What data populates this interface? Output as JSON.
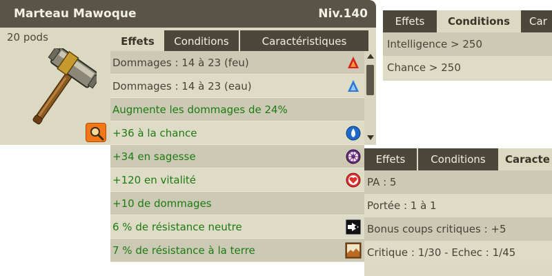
{
  "item": {
    "name": "Marteau Mawoque",
    "level": "Niv.140",
    "pods": "20 pods"
  },
  "tabs": {
    "effects": "Effets",
    "conditions": "Conditions",
    "characteristics": "Caractéristiques",
    "characteristics_cut_top": "Car",
    "characteristics_cut_bottom": "Caracte"
  },
  "effects": [
    {
      "text": "Dommages : 14 à 23 (feu)",
      "icon": "fire-element-icon"
    },
    {
      "text": "Dommages : 14 à 23 (eau)",
      "icon": "water-element-icon"
    },
    {
      "text": "Augmente les dommages de 24%",
      "icon": ""
    },
    {
      "text": "+36 à la chance",
      "icon": "chance-icon"
    },
    {
      "text": "+34 en sagesse",
      "icon": "wisdom-icon"
    },
    {
      "text": "+120 en vitalité",
      "icon": "vitality-heart-icon"
    },
    {
      "text": "+10 de dommages",
      "icon": ""
    },
    {
      "text": "6 % de résistance neutre",
      "icon": "neutral-resistance-icon"
    },
    {
      "text": "7 % de résistance à la terre",
      "icon": "earth-resistance-icon"
    }
  ],
  "conditions": [
    "Intelligence > 250",
    "Chance > 250"
  ],
  "characteristics": [
    "PA : 5",
    "Portée : 1 à 1",
    "Bonus coups critiques : +5",
    "Critique : 1/30 - Echec : 1/45"
  ],
  "colors": {
    "title_bar": "#5a5446",
    "tab_inactive": "#4c473a",
    "panel_bg": "#dcd9c3",
    "row_alt": "#ccc9b5",
    "effect_green": "#1e7a12",
    "zoom_button": "#f07818"
  }
}
